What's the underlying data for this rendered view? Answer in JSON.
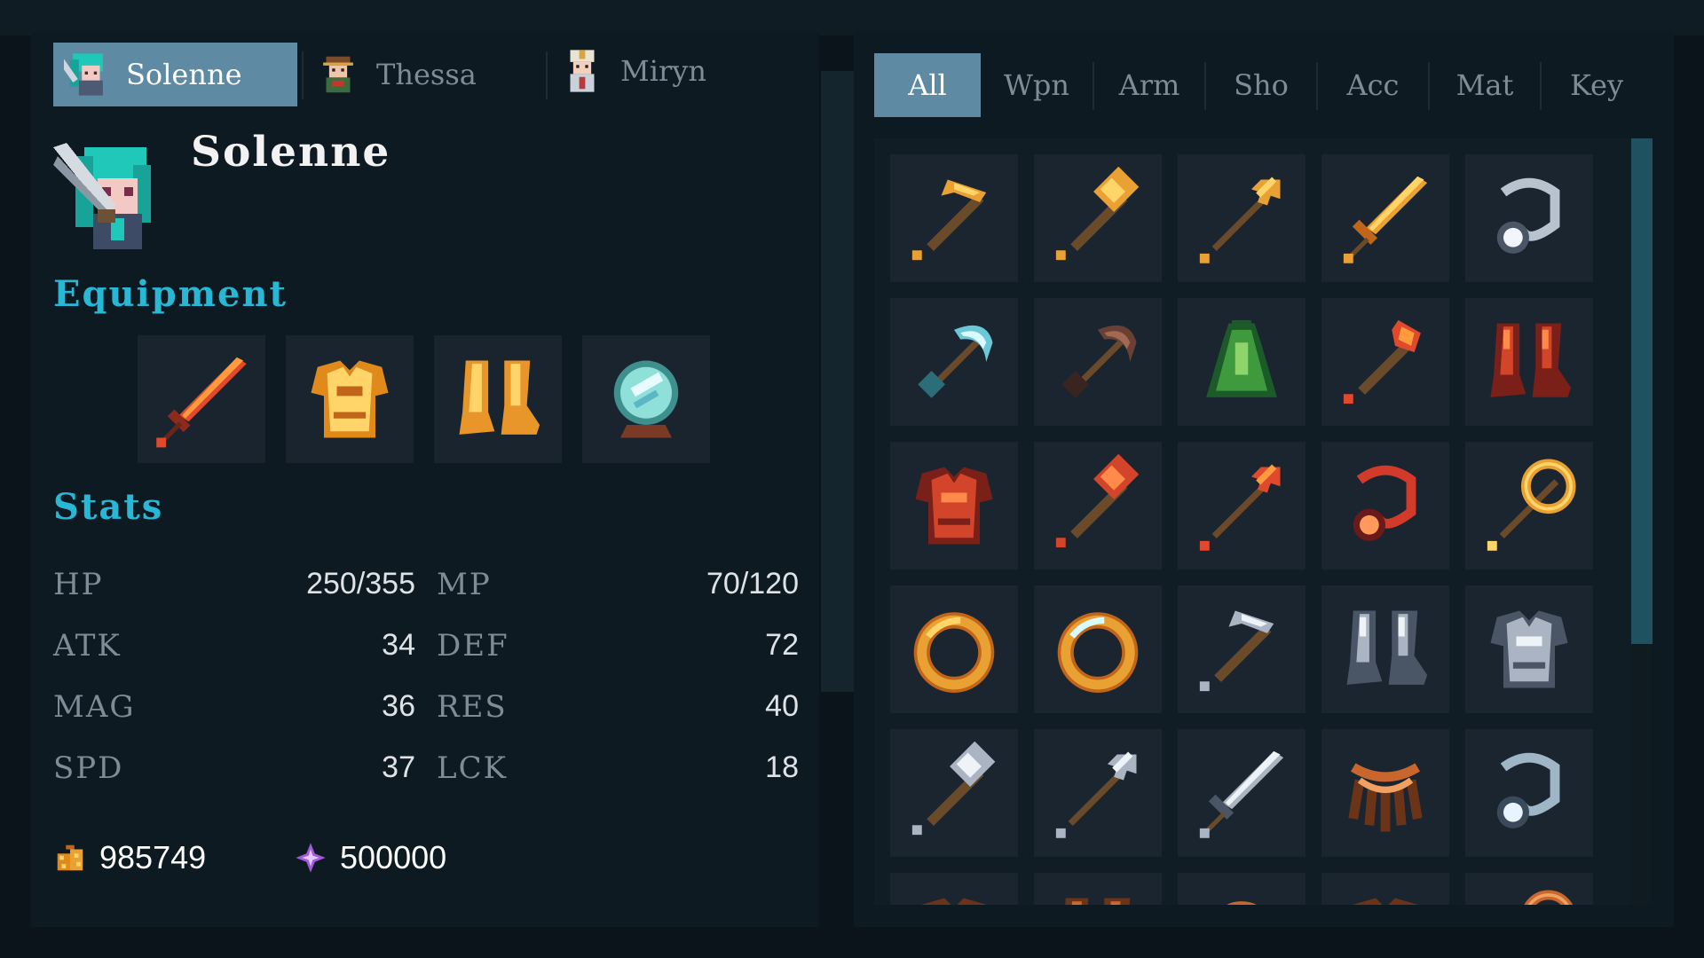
{
  "characters": {
    "tabs": [
      {
        "name": "Solenne",
        "icon": "knight-portrait-icon",
        "active": true
      },
      {
        "name": "Thessa",
        "icon": "adventurer-portrait-icon",
        "active": false
      },
      {
        "name": "Miryn",
        "icon": "cleric-portrait-icon",
        "active": false
      }
    ]
  },
  "character": {
    "name": "Solenne",
    "portrait_icon": "teal-haired-knight-icon"
  },
  "equipment": {
    "title": "Equipment",
    "slots": [
      {
        "slot": "weapon",
        "icon": "fire-sword-icon"
      },
      {
        "slot": "armor",
        "icon": "gold-armor-icon"
      },
      {
        "slot": "shoes",
        "icon": "gold-boots-icon"
      },
      {
        "slot": "accessory",
        "icon": "crystal-orb-icon"
      }
    ]
  },
  "stats": {
    "title": "Stats",
    "items": [
      {
        "label": "HP",
        "value": "250/355"
      },
      {
        "label": "MP",
        "value": "70/120"
      },
      {
        "label": "ATK",
        "value": "34"
      },
      {
        "label": "DEF",
        "value": "72"
      },
      {
        "label": "MAG",
        "value": "36"
      },
      {
        "label": "RES",
        "value": "40"
      },
      {
        "label": "SPD",
        "value": "37"
      },
      {
        "label": "LCK",
        "value": "18"
      }
    ]
  },
  "currency": {
    "gold": "985749",
    "gold_icon": "coin-bag-icon",
    "gems": "500000",
    "gems_icon": "purple-crystal-icon"
  },
  "inventory": {
    "tabs": [
      {
        "label": "All",
        "active": true
      },
      {
        "label": "Wpn",
        "active": false
      },
      {
        "label": "Arm",
        "active": false
      },
      {
        "label": "Sho",
        "active": false
      },
      {
        "label": "Acc",
        "active": false
      },
      {
        "label": "Mat",
        "active": false
      },
      {
        "label": "Key",
        "active": false
      }
    ],
    "items": [
      {
        "icon": "gold-pickaxe-icon"
      },
      {
        "icon": "gold-hammer-icon"
      },
      {
        "icon": "gold-trident-icon"
      },
      {
        "icon": "gold-sword-icon"
      },
      {
        "icon": "silver-amulet-icon"
      },
      {
        "icon": "ice-scythe-icon"
      },
      {
        "icon": "dark-scythe-icon"
      },
      {
        "icon": "green-cloak-icon"
      },
      {
        "icon": "fire-axe-icon"
      },
      {
        "icon": "red-boots-icon"
      },
      {
        "icon": "red-armor-icon"
      },
      {
        "icon": "red-hammer-icon"
      },
      {
        "icon": "fire-trident-icon"
      },
      {
        "icon": "ruby-amulet-icon"
      },
      {
        "icon": "gold-staff-icon"
      },
      {
        "icon": "gold-ring-icon"
      },
      {
        "icon": "diamond-ring-icon"
      },
      {
        "icon": "steel-pickaxe-icon"
      },
      {
        "icon": "steel-boots-icon"
      },
      {
        "icon": "steel-armor-icon"
      },
      {
        "icon": "steel-hammer-icon"
      },
      {
        "icon": "steel-trident-icon"
      },
      {
        "icon": "steel-sword-icon"
      },
      {
        "icon": "copper-necklace-icon"
      },
      {
        "icon": "pearl-amulet-icon"
      },
      {
        "icon": "copper-armor-icon"
      },
      {
        "icon": "copper-boots-icon"
      },
      {
        "icon": "copper-helm-icon"
      },
      {
        "icon": "copper-armor-icon"
      },
      {
        "icon": "copper-staff-icon"
      }
    ]
  },
  "colors": {
    "accent": "#28b7d4",
    "active_tab": "#5e8aa3",
    "panel_bg": "#0e1a22",
    "slot_bg": "#1a2530"
  }
}
